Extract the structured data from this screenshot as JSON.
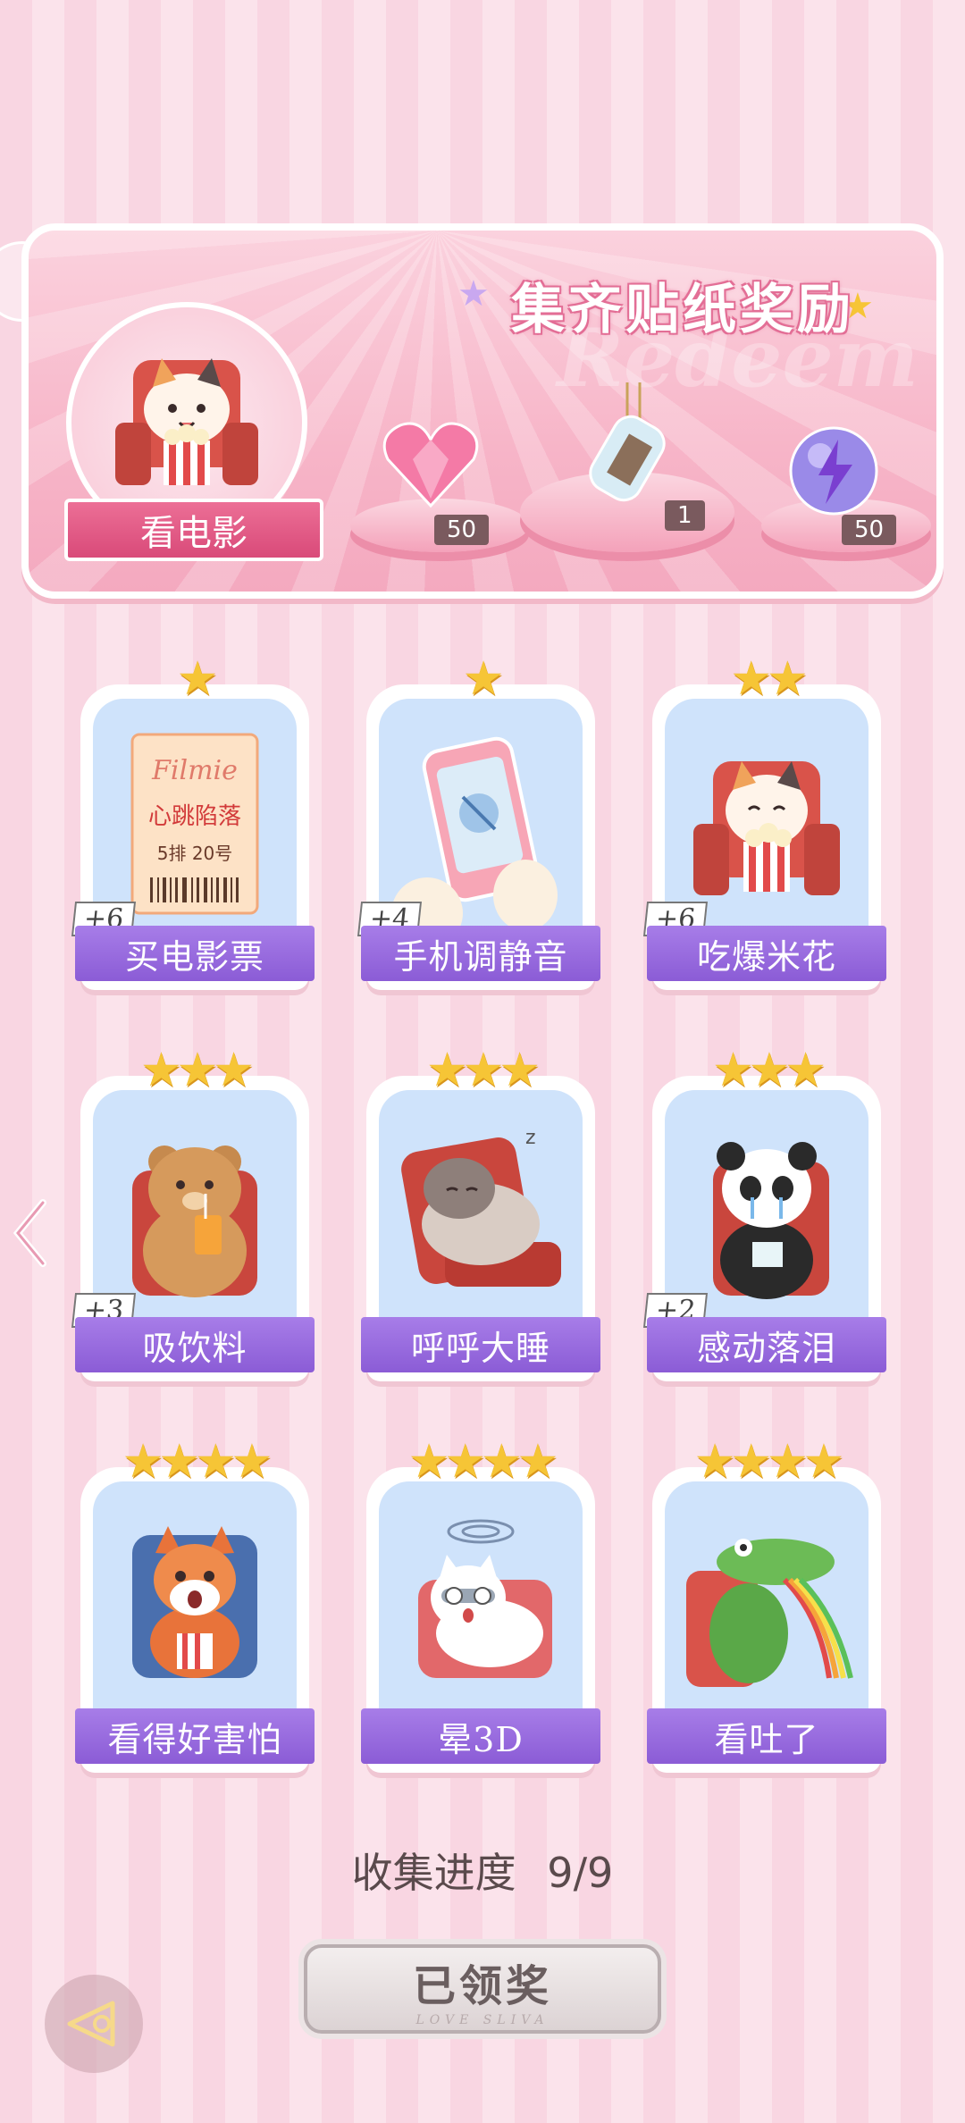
{
  "banner": {
    "title": "集齐贴纸奖励",
    "ghost_text": "Redeem",
    "theme_label": "看电影",
    "rewards": [
      {
        "icon": "heart-gem-icon",
        "count": "50"
      },
      {
        "icon": "message-bottle-icon",
        "count": "1"
      },
      {
        "icon": "energy-orb-icon",
        "count": "50"
      }
    ]
  },
  "cards": [
    {
      "label": "买电影票",
      "stars": "★",
      "bonus": "+6",
      "icon": "movie-ticket-icon",
      "ticket_brand": "Filmie",
      "ticket_title": "心跳陷落",
      "ticket_seat": "5排 20号"
    },
    {
      "label": "手机调静音",
      "stars": "★",
      "bonus": "+4",
      "icon": "muted-phone-icon"
    },
    {
      "label": "吃爆米花",
      "stars": "★★",
      "bonus": "+6",
      "icon": "cat-popcorn-icon"
    },
    {
      "label": "吸饮料",
      "stars": "★★★",
      "bonus": "+3",
      "icon": "bear-drink-icon"
    },
    {
      "label": "呼呼大睡",
      "stars": "★★★",
      "bonus": "",
      "icon": "sleeping-hamster-icon"
    },
    {
      "label": "感动落泪",
      "stars": "★★★",
      "bonus": "+2",
      "icon": "crying-panda-icon"
    },
    {
      "label": "看得好害怕",
      "stars": "★★★★",
      "bonus": "",
      "icon": "scared-fox-icon"
    },
    {
      "label": "晕3D",
      "stars": "★★★★",
      "bonus": "",
      "icon": "dizzy-cat-icon"
    },
    {
      "label": "看吐了",
      "stars": "★★★★",
      "bonus": "",
      "icon": "rainbow-crocodile-icon"
    }
  ],
  "progress": {
    "label": "收集进度",
    "value": "9/9",
    "fraction": 1.0
  },
  "claim_button": {
    "label": "已领奖",
    "sub": "LOVE SLIVA"
  },
  "colors": {
    "accent": "#8b5cd6",
    "star": "#f6c536",
    "banner_pink": "#f7b5c8"
  }
}
